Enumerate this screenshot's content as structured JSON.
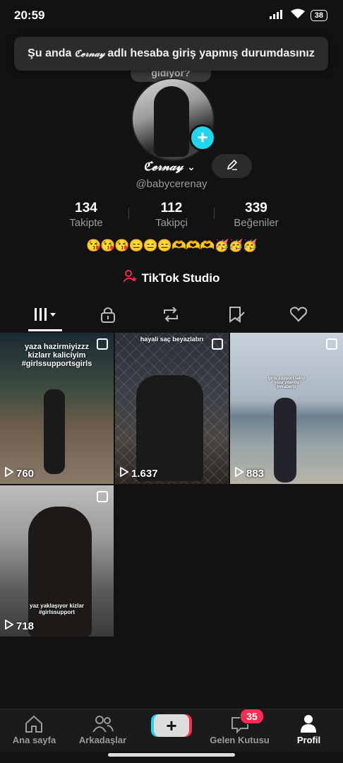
{
  "status": {
    "time": "20:59",
    "battery": "38"
  },
  "toast": {
    "prefix": "Şu anda",
    "nickname": "ℭ𝓮𝓇𝓃𝒶𝓎",
    "suffix": "adlı hesaba giriş yapmış durumdasınız"
  },
  "profile": {
    "note_bubble": "gidiyor?",
    "nickname": "ℭ𝓮𝓇𝓃𝒶𝓎",
    "handle": "@babycerenay",
    "stats": [
      {
        "value": "134",
        "label": "Takipte"
      },
      {
        "value": "112",
        "label": "Takipçi"
      },
      {
        "value": "339",
        "label": "Beğeniler"
      }
    ],
    "bio": "😘😘😘😑😑😑🫶🫶🫶🥳🥳🥳",
    "studio_label": "TikTok Studio"
  },
  "videos": [
    {
      "caption": "yaza hazirmiyizzz kizlarr kaliciyim #girlssupportsgirls",
      "views": "760"
    },
    {
      "caption": "hayali saç beyazlatırı",
      "views": "1.637"
    },
    {
      "caption": "girls support takip yaza yılanda beraberiz",
      "views": "883"
    },
    {
      "caption": "yaz yaklaşıyor kizlar #girlssupport",
      "views": "718"
    }
  ],
  "nav": {
    "home": "Ana sayfa",
    "friends": "Arkadaşlar",
    "create": "+",
    "inbox": "Gelen Kutusu",
    "inbox_badge": "35",
    "profile": "Profil"
  },
  "colors": {
    "accent_cyan": "#20d5ec",
    "accent_red": "#fe2c55",
    "background": "#121212"
  },
  "icons": [
    "wifi-icon",
    "signal-icon",
    "pencil-icon",
    "grid-icon",
    "lock-icon",
    "repost-icon",
    "saved-icon",
    "liked-icon",
    "play-icon",
    "home-icon",
    "friends-icon",
    "inbox-icon",
    "profile-icon"
  ]
}
